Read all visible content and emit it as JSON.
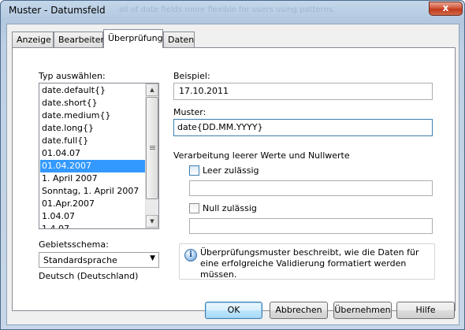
{
  "window": {
    "title": "Muster - Datumsfeld",
    "background_hint": "all of date fields more flexible for users using patterns.",
    "close_label": "x"
  },
  "tabs": [
    {
      "label": "Anzeige",
      "active": false
    },
    {
      "label": "Bearbeiten",
      "active": false
    },
    {
      "label": "Überprüfung",
      "active": true
    },
    {
      "label": "Daten",
      "active": false
    }
  ],
  "type_select": {
    "label": "Typ auswählen:",
    "items": [
      "date.default{}",
      "date.short{}",
      "date.medium{}",
      "date.long{}",
      "date.full{}",
      "01.04.07",
      "01.04.2007",
      "1. April 2007",
      "Sonntag, 1. April 2007",
      "01.Apr.2007",
      "1.04.07",
      "1.4.07"
    ],
    "selected_index": 6,
    "scroll_up": "▲",
    "scroll_down": "▼"
  },
  "locale": {
    "label": "Gebietsschema:",
    "value": "Standardsprache",
    "arrow": "▼",
    "description": "Deutsch (Deutschland)"
  },
  "example": {
    "label": "Beispiel:",
    "value": "17.10.2011"
  },
  "pattern": {
    "label": "Muster:",
    "value": "date{DD.MM.YYYY}"
  },
  "empty_null": {
    "heading": "Verarbeitung leerer Werte und Nullwerte",
    "empty_label": "Leer zulässig",
    "empty_checked": false,
    "empty_value": "",
    "null_label": "Null zulässig",
    "null_checked": false,
    "null_value": ""
  },
  "info": {
    "icon_glyph": "i",
    "text": "Überprüfungsmuster beschreibt, wie die Daten für eine erfolgreiche Validierung formatiert werden müssen."
  },
  "buttons": {
    "ok": "OK",
    "cancel": "Abbrechen",
    "apply": "Übernehmen",
    "help": "Hilfe"
  }
}
